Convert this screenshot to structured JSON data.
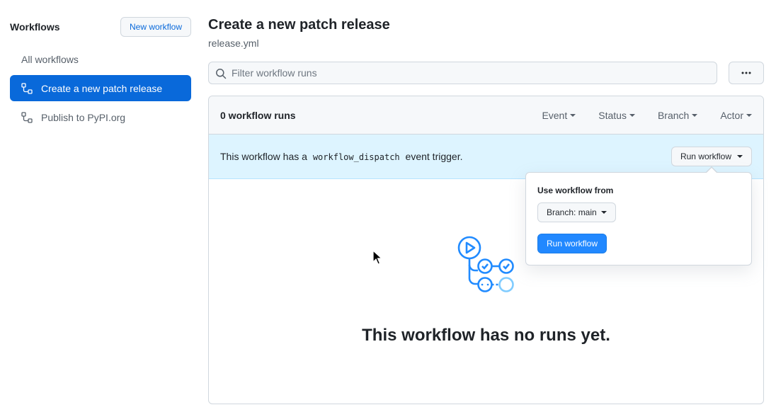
{
  "sidebar": {
    "title": "Workflows",
    "new_workflow_label": "New workflow",
    "items": [
      {
        "label": "All workflows",
        "icon": "none"
      },
      {
        "label": "Create a new patch release",
        "icon": "workflow-icon"
      },
      {
        "label": "Publish to PyPI.org",
        "icon": "workflow-icon"
      }
    ]
  },
  "main": {
    "title": "Create a new patch release",
    "filename": "release.yml",
    "search_placeholder": "Filter workflow runs",
    "runs_count": "0 workflow runs",
    "filters": [
      "Event",
      "Status",
      "Branch",
      "Actor"
    ],
    "dispatch": {
      "prefix": "This workflow has a",
      "code": "workflow_dispatch",
      "suffix": "event trigger.",
      "run_button": "Run workflow"
    },
    "empty_title": "This workflow has no runs yet."
  },
  "popover": {
    "label": "Use workflow from",
    "branch_button": "Branch: main",
    "run_button": "Run workflow"
  },
  "colors": {
    "accent": "#0969da",
    "info_bg": "#ddf4ff",
    "run_button": "#2188ff"
  }
}
